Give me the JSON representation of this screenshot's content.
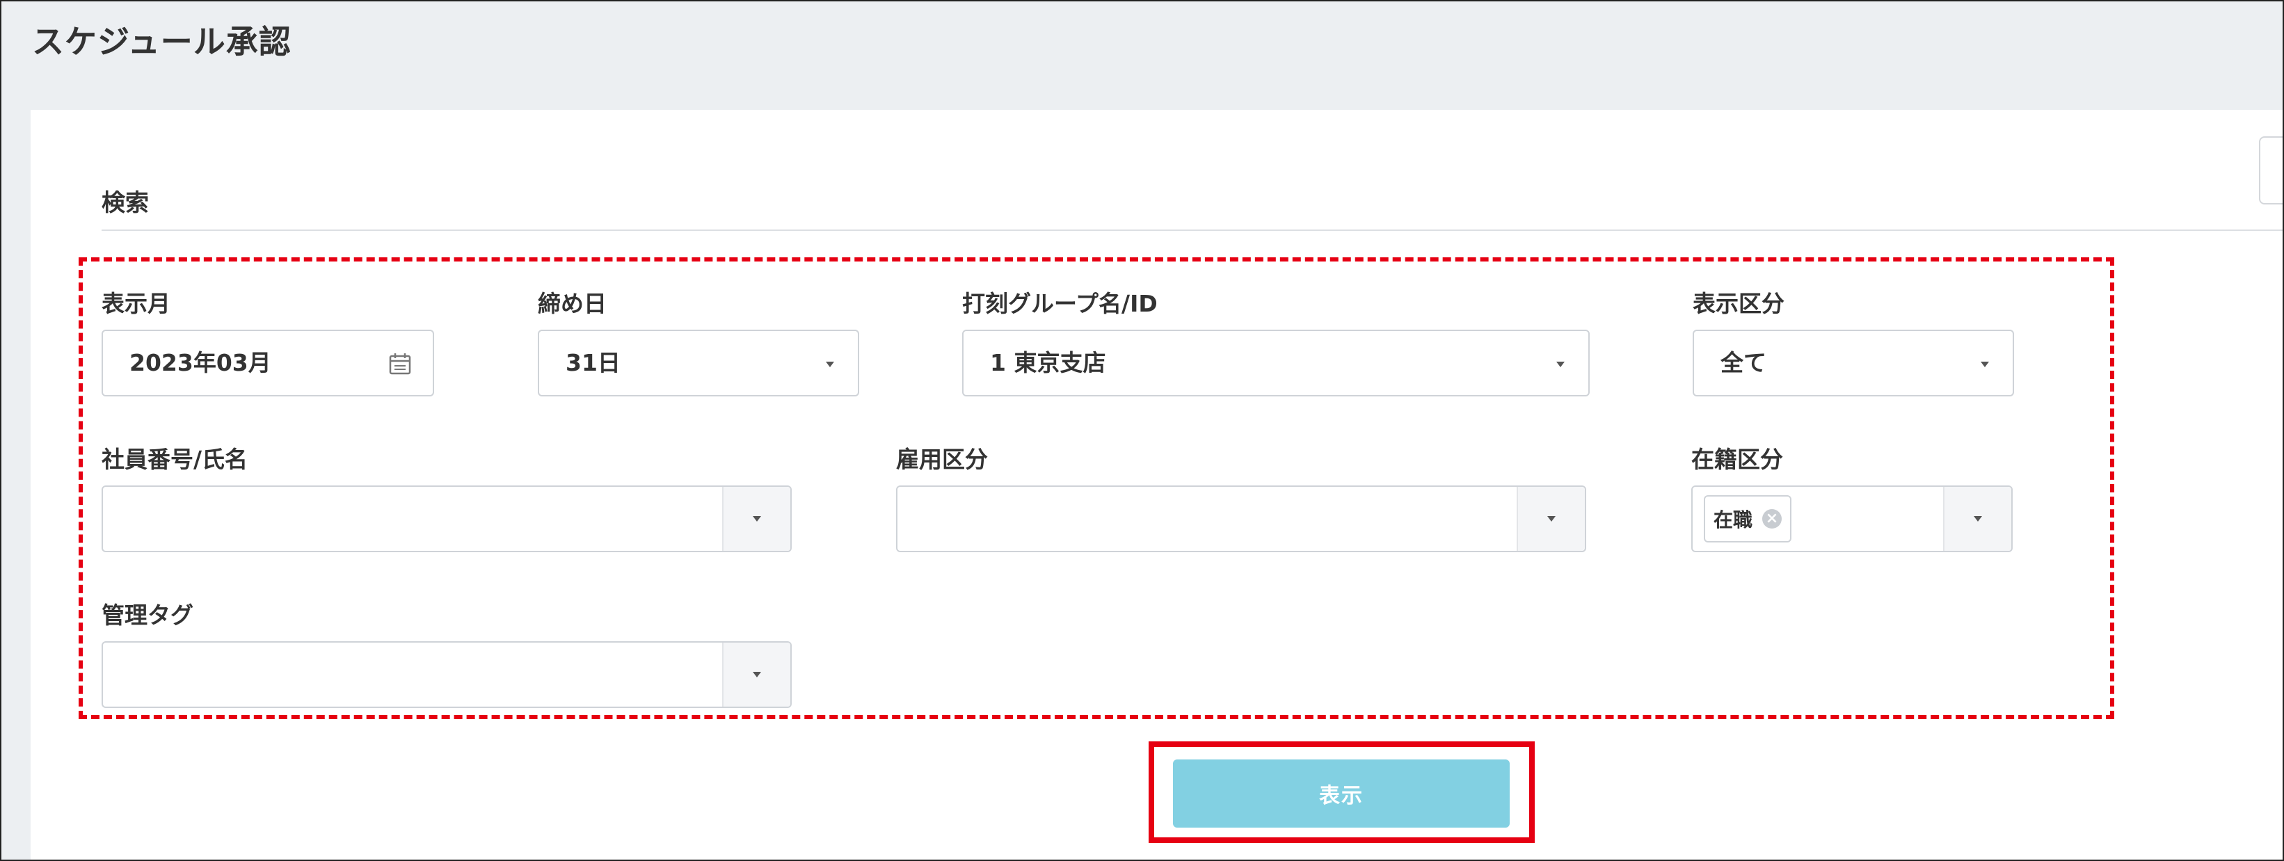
{
  "page": {
    "title": "スケジュール承認"
  },
  "search": {
    "section_title": "検索",
    "fields": {
      "display_month": {
        "label": "表示月",
        "value": "2023年03月",
        "icon": "calendar-icon"
      },
      "closing_day": {
        "label": "締め日",
        "value": "31日"
      },
      "group": {
        "label": "打刻グループ名/ID",
        "value": "1 東京支店"
      },
      "display_type": {
        "label": "表示区分",
        "value": "全て"
      },
      "employee": {
        "label": "社員番号/氏名",
        "value": ""
      },
      "employment_type": {
        "label": "雇用区分",
        "value": ""
      },
      "enrollment": {
        "label": "在籍区分",
        "tags": [
          "在職"
        ]
      },
      "management_tag": {
        "label": "管理タグ",
        "value": ""
      }
    },
    "submit_label": "表示"
  },
  "colors": {
    "highlight": "#e60012",
    "button": "#82d0e2",
    "header_bg": "#eceff2"
  }
}
